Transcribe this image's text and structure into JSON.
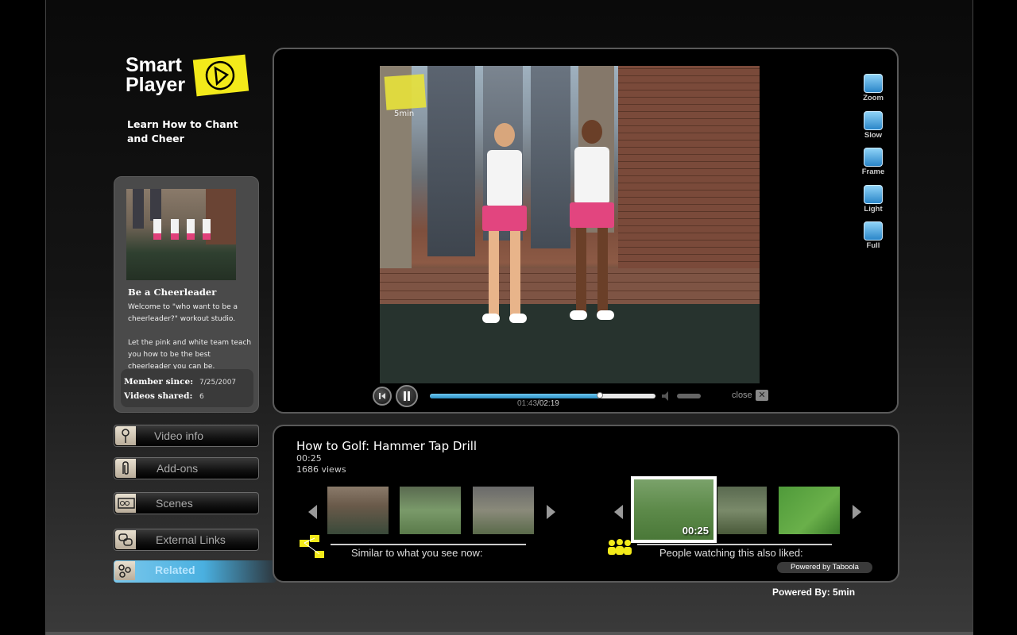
{
  "logo": {
    "text": "Smart\nPlayer"
  },
  "subtitle": "Learn How to Chant and Cheer",
  "author": {
    "video_title": "Be a Cheerleader",
    "description": "Welcome to \"who want to be a cheerleader?\" workout studio.\n\nLet the pink and white team teach you how to be the best cheerleader you can be.",
    "member_since_label": "Member since:",
    "member_since_value": "7/25/2007",
    "videos_shared_label": "Videos shared:",
    "videos_shared_value": "6"
  },
  "menu": {
    "items": [
      {
        "label": "Video info",
        "icon": "info-icon"
      },
      {
        "label": "Add-ons",
        "icon": "paperclip-icon"
      },
      {
        "label": "Scenes",
        "icon": "film-strip-icon"
      },
      {
        "label": "External Links",
        "icon": "link-icon"
      },
      {
        "label": "Related",
        "icon": "related-icon",
        "active": true
      }
    ]
  },
  "video": {
    "watermark": "5min",
    "current_time": "01:43",
    "total_time": "02:19",
    "progress": 0.755,
    "close_label": "close"
  },
  "tools": [
    {
      "label": "Zoom",
      "icon": "zoom-icon"
    },
    {
      "label": "Slow",
      "icon": "slow-icon"
    },
    {
      "label": "Frame",
      "icon": "frame-icon"
    },
    {
      "label": "Light",
      "icon": "light-icon"
    },
    {
      "label": "Full",
      "icon": "fullscreen-icon"
    }
  ],
  "related": {
    "title": "How to Golf: Hammer Tap Drill",
    "duration": "00:25",
    "views": "1686 views",
    "similar_caption": "Similar to what you see now:",
    "people_caption": "People watching this also liked:",
    "featured_duration": "00:25",
    "taboola": "Powered by Taboola"
  },
  "footer": {
    "powered": "Powered By: 5min"
  },
  "colors": {
    "accent": "#4ab0e0",
    "brand_yellow": "#f3ea1a",
    "pink": "#e2457f"
  }
}
